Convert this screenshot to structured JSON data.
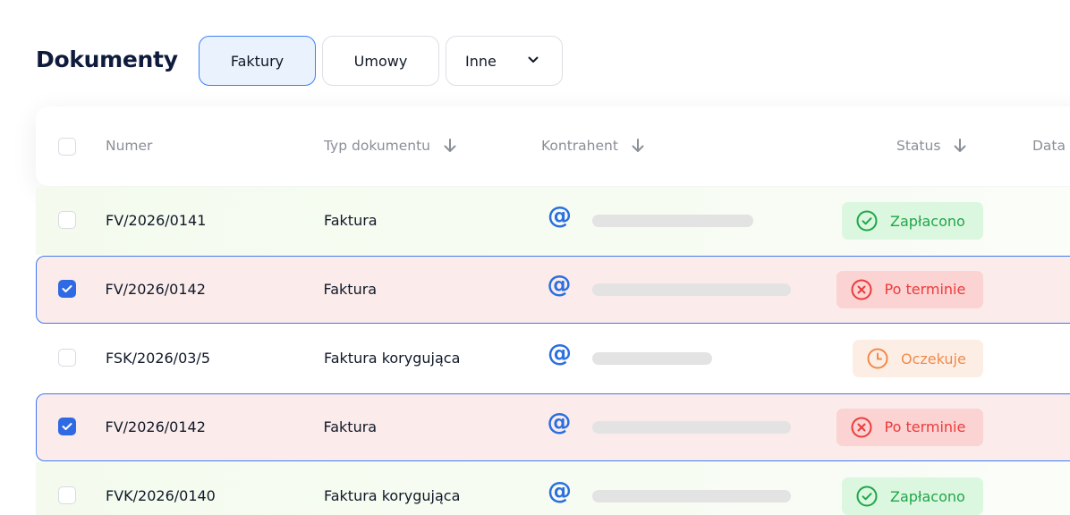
{
  "page": {
    "title": "Dokumenty"
  },
  "tabs": [
    {
      "label": "Faktury",
      "active": true
    },
    {
      "label": "Umowy",
      "active": false
    },
    {
      "label": "Inne",
      "active": false,
      "has_dropdown": true
    }
  ],
  "table": {
    "columns": {
      "numer": "Numer",
      "typ": "Typ dokumentu",
      "kontrahent": "Kontrahent",
      "status": "Status",
      "data": "Data"
    },
    "rows": [
      {
        "numer": "FV/2026/0141",
        "typ": "Faktura",
        "kontrahent_icon": "@",
        "status": "Zapłacono",
        "status_kind": "paid",
        "selected": false
      },
      {
        "numer": "FV/2026/0142",
        "typ": "Faktura",
        "kontrahent_icon": "@",
        "status": "Po terminie",
        "status_kind": "overdue",
        "selected": true
      },
      {
        "numer": "FSK/2026/03/5",
        "typ": "Faktura korygująca",
        "kontrahent_icon": "@",
        "status": "Oczekuje",
        "status_kind": "pending",
        "selected": false
      },
      {
        "numer": "FV/2026/0142",
        "typ": "Faktura",
        "kontrahent_icon": "@",
        "status": "Po terminie",
        "status_kind": "overdue",
        "selected": true
      },
      {
        "numer": "FVK/2026/0140",
        "typ": "Faktura korygująca",
        "kontrahent_icon": "@",
        "status": "Zapłacono",
        "status_kind": "paid",
        "selected": false
      }
    ]
  },
  "colors": {
    "accent": "#3b82f6",
    "paid": "#20a649",
    "overdue": "#ec3b3b",
    "pending": "#f08a4b"
  }
}
